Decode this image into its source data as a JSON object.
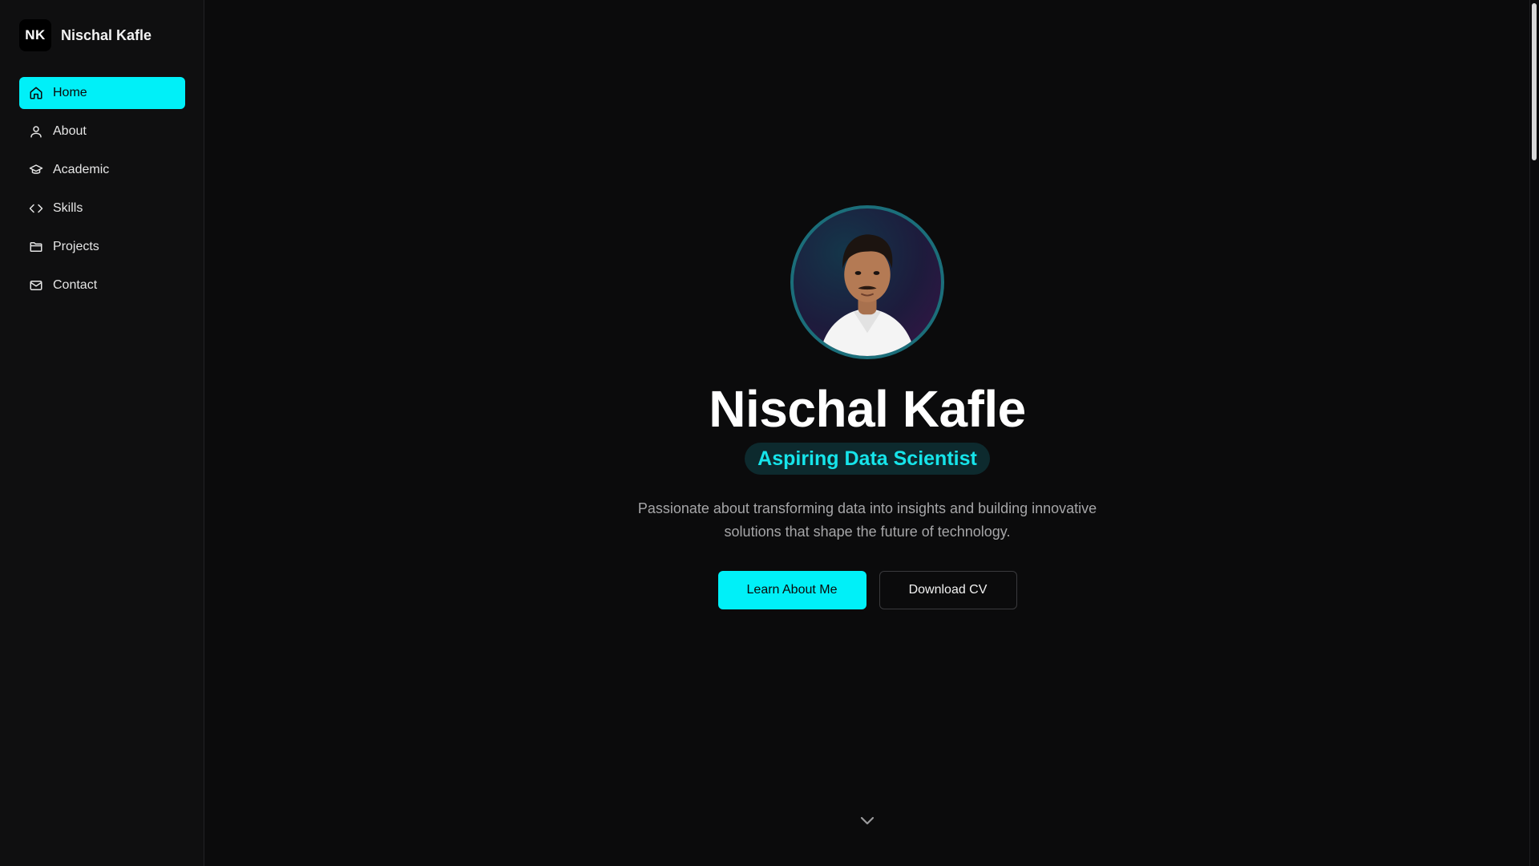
{
  "brand": {
    "initials": "NK",
    "name": "Nischal Kafle"
  },
  "sidebar": {
    "items": [
      {
        "label": "Home",
        "icon": "home-icon",
        "active": true
      },
      {
        "label": "About",
        "icon": "user-icon",
        "active": false
      },
      {
        "label": "Academic",
        "icon": "graduation-cap-icon",
        "active": false
      },
      {
        "label": "Skills",
        "icon": "code-icon",
        "active": false
      },
      {
        "label": "Projects",
        "icon": "folder-icon",
        "active": false
      },
      {
        "label": "Contact",
        "icon": "mail-icon",
        "active": false
      }
    ]
  },
  "hero": {
    "name": "Nischal Kafle",
    "role": "Aspiring Data Scientist",
    "description": "Passionate about transforming data into insights and building innovative solutions that shape the future of technology.",
    "primary_button": "Learn About Me",
    "secondary_button": "Download CV"
  },
  "colors": {
    "accent": "#00f0f8",
    "background": "#0b0b0c",
    "sidebar": "#0f0f10"
  },
  "icons": {
    "scroll_down": "chevron-down-icon"
  }
}
